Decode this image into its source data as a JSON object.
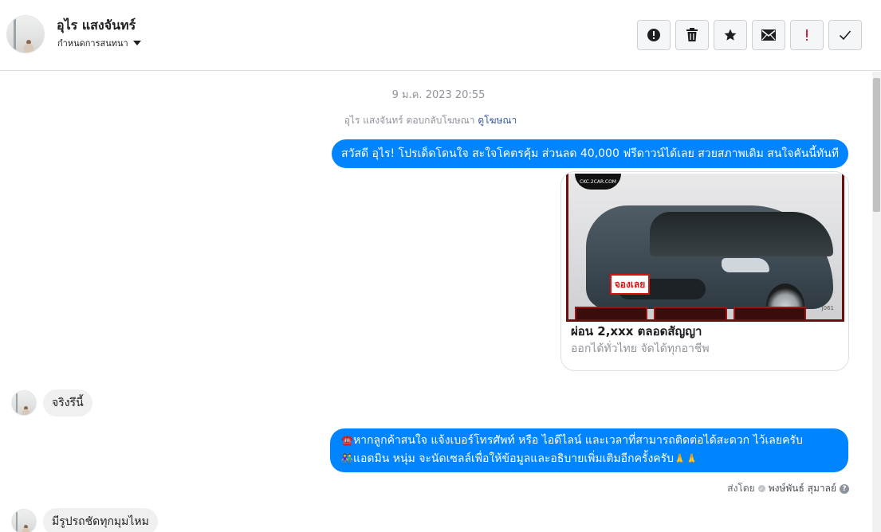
{
  "header": {
    "contact_name": "อุไร แสงจันทร์",
    "assign_label": "กำหนดการสนทนา",
    "actions": [
      {
        "name": "report-spam",
        "icon": "alert-circle-icon"
      },
      {
        "name": "delete",
        "icon": "trash-icon"
      },
      {
        "name": "star",
        "icon": "star-icon"
      },
      {
        "name": "mark-unread",
        "icon": "envelope-icon"
      },
      {
        "name": "follow-up",
        "icon": "exclamation-icon",
        "color": "#e41e3f"
      },
      {
        "name": "mark-done",
        "icon": "checkmark-icon"
      }
    ]
  },
  "thread": {
    "timestamp": "9 ม.ค. 2023 20:55",
    "reply_notice": {
      "text": "อุไร แสงจันทร์ ตอบกลับโฆษณา",
      "link": "ดูโฆษณา"
    },
    "messages": {
      "out1": "สวัสดี อุไร! โปรเด็ดโดนใจ สะใจโคตรคุ้ม ส่วนลด 40,000 ฟรีดาวน์ได้เลย สวยสภาพเดิม สนใจคันนี้ทันที",
      "in1": "จริงรึนี้",
      "out2_line1": "หากลูกค้าสนใจ แจ้งเบอร์โทรศัพท์ หรือ ไอดีไลน์ และเวลาที่สามารถติดต่อได้สะดวก ไว้เลยครับ",
      "out2_line2": "แอดมิน หนุ่ม จะนัดเซลล์เพื่อให้ข้อมูลและอธิบายเพิ่มเติมอีกครั้งครับ",
      "in2": "มีรูปรถชัดทุกมุมไหม"
    },
    "ad_card": {
      "title": "ผ่อน 2,xxx ตลอดสัญญา",
      "subtitle": "ออกได้ทั่วไทย จัดได้ทุกอาชีพ",
      "image": {
        "logo": "CKC.2CAR.COM",
        "plate": "จองเลย",
        "code": "J061"
      }
    },
    "sent_by": {
      "prefix": "ส่งโดย",
      "agent": "พงษ์พันธ์ สุมาลย์"
    }
  },
  "colors": {
    "outgoing_bubble": "#0084ff",
    "incoming_bubble": "#f1f0f0",
    "link": "#385898"
  }
}
